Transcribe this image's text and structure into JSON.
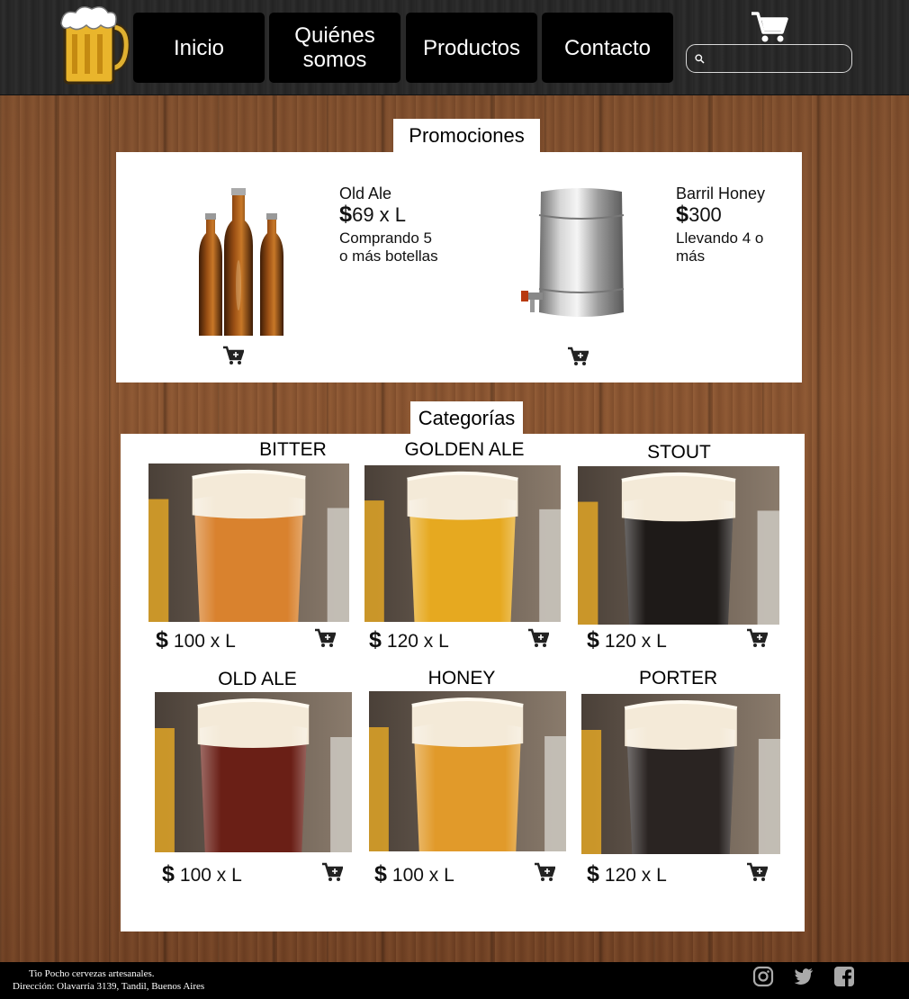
{
  "nav": {
    "items": [
      "Inicio",
      "Quiénes somos",
      "Productos",
      "Contacto"
    ],
    "search_placeholder": ""
  },
  "promotions": {
    "title": "Promociones",
    "items": [
      {
        "name": "Old Ale",
        "price": "69 x L",
        "note": "Comprando 5 o más botellas"
      },
      {
        "name": "Barril Honey",
        "price": "300",
        "note": "Llevando 4 o más"
      }
    ]
  },
  "categories": {
    "title": "Categorías",
    "items": [
      {
        "name": "BITTER",
        "price": "100 x L",
        "beer_color": "#d9822e"
      },
      {
        "name": "GOLDEN ALE",
        "price": "120 x L",
        "beer_color": "#e6a920"
      },
      {
        "name": "STOUT",
        "price": "120 x L",
        "beer_color": "#1e1a18"
      },
      {
        "name": "OLD ALE",
        "price": "100 x L",
        "beer_color": "#6a1f16"
      },
      {
        "name": "HONEY",
        "price": "100 x L",
        "beer_color": "#e19a2a"
      },
      {
        "name": "PORTER",
        "price": "120 x L",
        "beer_color": "#2a2422"
      }
    ]
  },
  "currency_symbol": "$",
  "footer": {
    "line1": "Tio Pocho cervezas artesanales.",
    "line2": "Dirección: Olavarría 3139, Tandil, Buenos Aires",
    "social_icons": [
      "instagram-icon",
      "twitter-icon",
      "facebook-icon"
    ]
  },
  "colors": {
    "header_bg": "#2a2a2a",
    "nav_button_bg": "#000000",
    "wood": "#7a4a2a",
    "footer_bg": "#000000"
  }
}
